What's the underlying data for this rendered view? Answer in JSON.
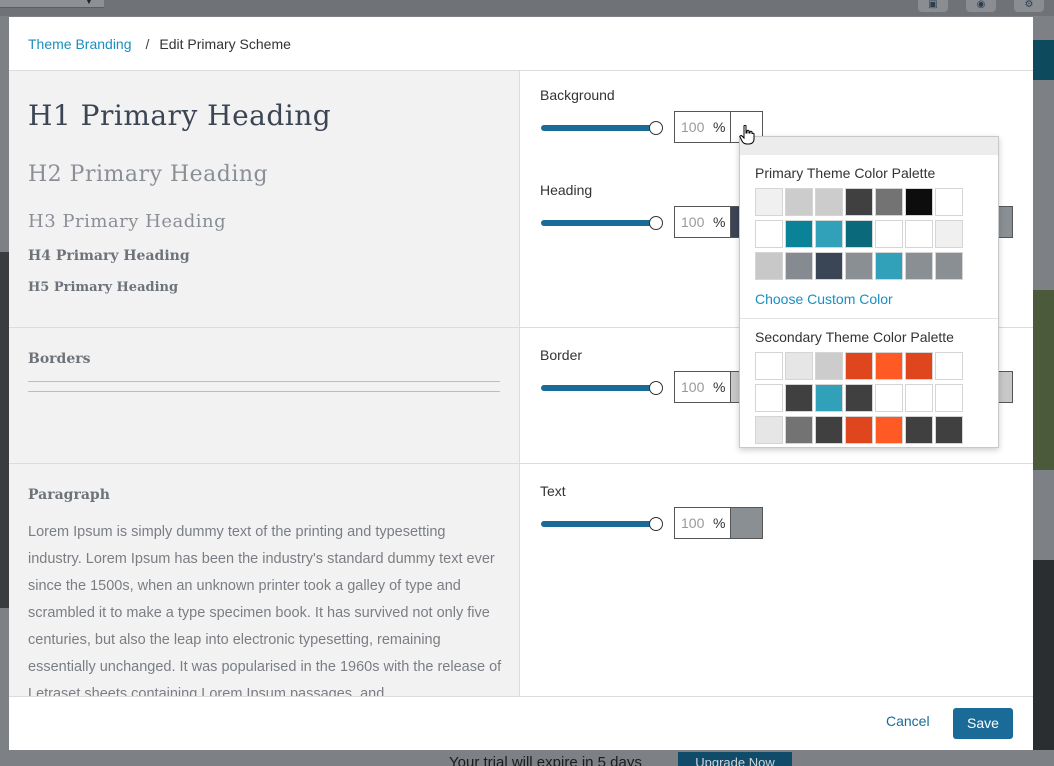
{
  "background_app": {
    "trial_text": "Your trial will expire in 5 days",
    "upgrade_label": "Upgrade Now"
  },
  "breadcrumb": {
    "parent": "Theme Branding",
    "separator": "/",
    "current": "Edit Primary Scheme"
  },
  "preview": {
    "h1": "H1 Primary Heading",
    "h2": "H2 Primary Heading",
    "h3": "H3 Primary Heading",
    "h4": "H4 Primary Heading",
    "h5": "H5 Primary Heading",
    "borders_title": "Borders",
    "paragraph_title": "Paragraph",
    "paragraph_text": "Lorem Ipsum is simply dummy text of the printing and typesetting industry. Lorem Ipsum has been the industry's standard dummy text ever since the 1500s, when an unknown printer took a galley of type and scrambled it to make a type specimen book. It has survived not only five centuries, but also the leap into electronic typesetting, remaining essentially unchanged. It was popularised in the 1960s with the release of Letraset sheets containing Lorem Ipsum passages, and"
  },
  "controls": {
    "background": {
      "label": "Background",
      "value": "100",
      "unit": "%",
      "color": "#ffffff",
      "slider_level": 1.0
    },
    "heading": {
      "label": "Heading",
      "value": "100",
      "unit": "%",
      "color": "#3a4556",
      "slider_level": 1.0
    },
    "border": {
      "label": "Border",
      "value": "100",
      "unit": "%",
      "color": "#c8c8c8",
      "slider_level": 1.0
    },
    "text": {
      "label": "Text",
      "value": "100",
      "unit": "%",
      "color": "#8a8f94",
      "slider_level": 1.0
    }
  },
  "color_picker": {
    "primary_title": "Primary Theme Color Palette",
    "primary_colors": [
      "#f0f0f0",
      "#cccccc",
      "#cccccc",
      "#404040",
      "#737373",
      "#0d0d0d",
      "#ffffff",
      "#ffffff",
      "#0a8399",
      "#31a1ba",
      "#0a6a7c",
      "#ffffff",
      "#ffffff",
      "#f0f0f0",
      "#c8c8c8",
      "#868b91",
      "#3a4556",
      "#8a8f94",
      "#31a1ba",
      "#8a8f94",
      "#8a8f94"
    ],
    "custom_link": "Choose Custom Color",
    "secondary_title": "Secondary Theme Color Palette",
    "secondary_colors": [
      "#ffffff",
      "#e6e6e6",
      "#cccccc",
      "#e0461e",
      "#ff5a24",
      "#e0461e",
      "#ffffff",
      "#ffffff",
      "#404040",
      "#31a1ba",
      "#404040",
      "#ffffff",
      "#ffffff",
      "#ffffff",
      "#e6e6e6",
      "#737373",
      "#404040",
      "#e0461e",
      "#ff5a24",
      "#404040",
      "#404040"
    ]
  },
  "footer": {
    "cancel_label": "Cancel",
    "save_label": "Save"
  },
  "theme_colors": {
    "accent": "#1a6b98",
    "link": "#1a8fbf"
  }
}
